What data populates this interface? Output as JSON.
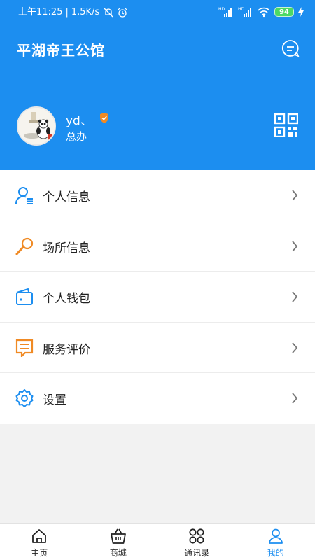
{
  "status_bar": {
    "time": "上午11:25",
    "speed": "1.5K/s",
    "battery": "94"
  },
  "header": {
    "title": "平湖帝王公馆"
  },
  "profile": {
    "name": "yd、",
    "department": "总办"
  },
  "menu": {
    "items": [
      {
        "label": "个人信息",
        "icon": "user-info-icon"
      },
      {
        "label": "场所信息",
        "icon": "microphone-icon"
      },
      {
        "label": "个人钱包",
        "icon": "wallet-icon"
      },
      {
        "label": "服务评价",
        "icon": "comment-icon"
      },
      {
        "label": "设置",
        "icon": "gear-icon"
      }
    ]
  },
  "tabbar": {
    "tabs": [
      {
        "label": "主页",
        "icon": "home-icon"
      },
      {
        "label": "商城",
        "icon": "basket-icon"
      },
      {
        "label": "通讯录",
        "icon": "grid-icon"
      },
      {
        "label": "我的",
        "icon": "person-icon",
        "active": true
      }
    ]
  },
  "colors": {
    "brand": "#1c8ef0",
    "orange": "#f08a24",
    "battery": "#4cd964"
  }
}
